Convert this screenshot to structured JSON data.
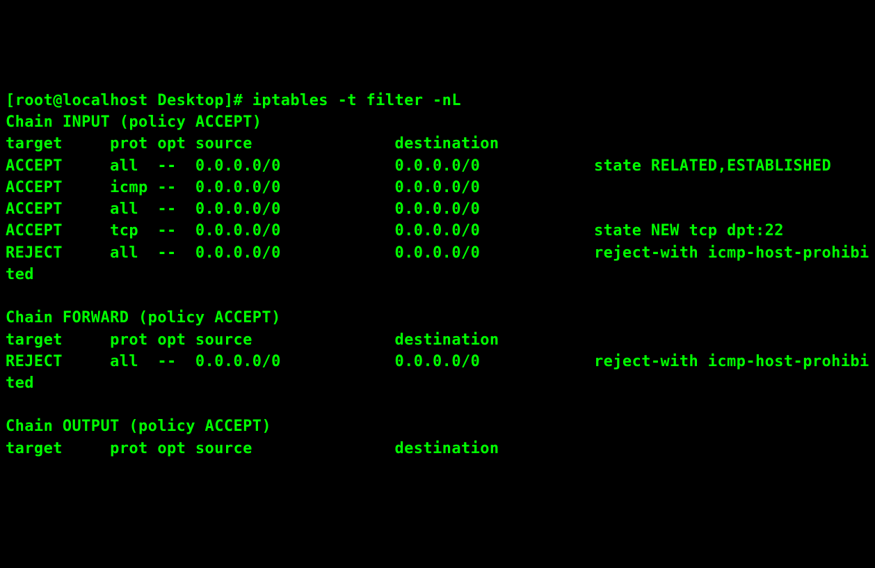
{
  "prompt": "[root@localhost Desktop]# ",
  "command": "iptables -t filter -nL",
  "chains": [
    {
      "header": "Chain INPUT (policy ACCEPT)",
      "columns": "target     prot opt source               destination",
      "rules": [
        "ACCEPT     all  --  0.0.0.0/0            0.0.0.0/0            state RELATED,ESTABLISHED",
        "ACCEPT     icmp --  0.0.0.0/0            0.0.0.0/0",
        "ACCEPT     all  --  0.0.0.0/0            0.0.0.0/0",
        "ACCEPT     tcp  --  0.0.0.0/0            0.0.0.0/0            state NEW tcp dpt:22",
        "REJECT     all  --  0.0.0.0/0            0.0.0.0/0            reject-with icmp-host-prohibited"
      ]
    },
    {
      "header": "Chain FORWARD (policy ACCEPT)",
      "columns": "target     prot opt source               destination",
      "rules": [
        "REJECT     all  --  0.0.0.0/0            0.0.0.0/0            reject-with icmp-host-prohibited"
      ]
    },
    {
      "header": "Chain OUTPUT (policy ACCEPT)",
      "columns": "target     prot opt source               destination",
      "rules": []
    }
  ]
}
